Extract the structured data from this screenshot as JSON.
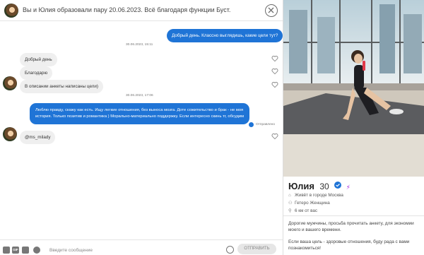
{
  "header": {
    "title": "Вы и Юлия образовали пару 20.06.2023. Всё благодаря функции Буст."
  },
  "messages": [
    {
      "kind": "out",
      "text": "Добрый день. Классно выглядишь, какие цели тут?"
    },
    {
      "kind": "timestamp",
      "text": "30.06.2023, 15:11"
    },
    {
      "kind": "in",
      "text": "Добрый день"
    },
    {
      "kind": "in",
      "text": "Благодарю"
    },
    {
      "kind": "in",
      "text": "В описании анкеты написаны цели)"
    },
    {
      "kind": "timestamp",
      "text": "30.06.2023, 17:06"
    },
    {
      "kind": "out",
      "lines": [
        "Люблю правду, скажу как есть. Ищу легкие отношения, без выноса мозга. Доте сожительство и брак - не моя",
        "история. Только позитив и романтика ) Морально-материально поддержку. Если интересно скинь тг, обсудим"
      ]
    },
    {
      "kind": "status",
      "text": "Отправлено"
    },
    {
      "kind": "in",
      "text": "@ms_milady"
    }
  ],
  "composer": {
    "placeholder": "Введите сообщение",
    "gif_label": "GIF",
    "send_label": "ОТПРАВИТЬ"
  },
  "profile": {
    "name": "Юлия",
    "age": "30",
    "lives_in": "Живёт в городе Москва",
    "orientation": "Гетеро Женщина",
    "distance": "6 км от вас",
    "bio_1_lines": [
      "Дорогие мужчины, просьба прочитать анкету, для экономии",
      "моего и вашего времени."
    ],
    "bio_2_lines": [
      "Если ваша цель - здоровые отношения, буду рада с вами",
      "познакомиться!"
    ]
  },
  "colors": {
    "accent": "#1f74d6",
    "incoming_bubble": "#efefef",
    "boost": "#a52ae0"
  },
  "icons": {
    "close": "close-icon",
    "like": "heart-icon",
    "verified": "verified-icon",
    "boost": "lightning-icon",
    "location": "location-pin-icon"
  }
}
